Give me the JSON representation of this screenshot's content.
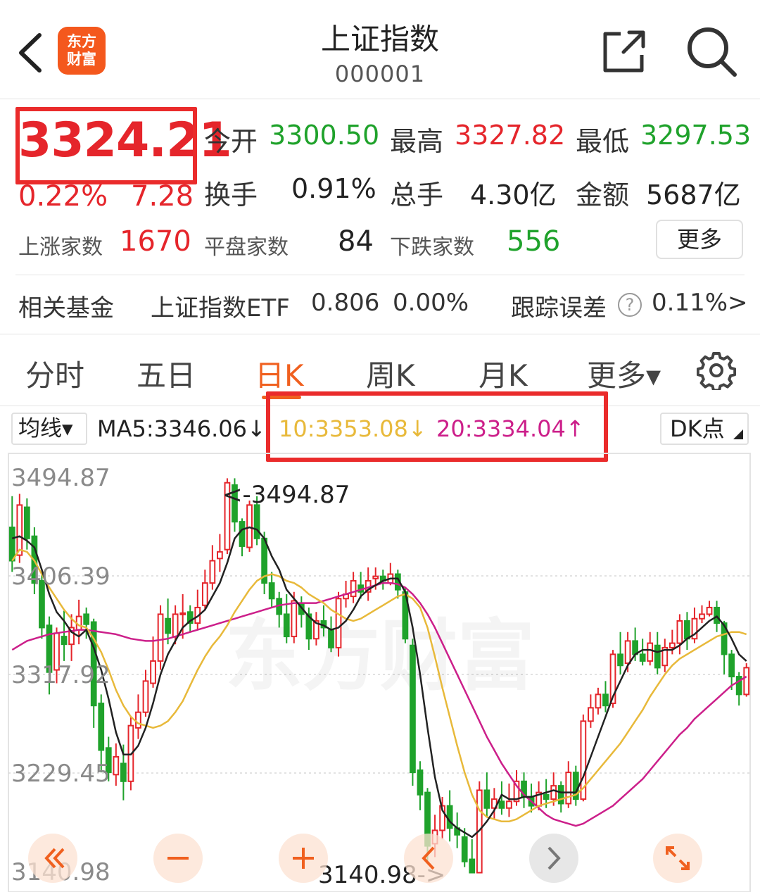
{
  "header": {
    "logo_line1": "东方",
    "logo_line2": "财富",
    "title": "上证指数",
    "code": "000001"
  },
  "quote": {
    "price": "3324.21",
    "change_pct": "0.22%",
    "change_abs": "7.28",
    "stats": [
      {
        "label": "今开",
        "value": "3300.50",
        "color": "#1fa22b"
      },
      {
        "label": "最高",
        "value": "3327.82",
        "color": "#e5252b"
      },
      {
        "label": "最低",
        "value": "3297.53",
        "color": "#1fa22b"
      },
      {
        "label": "换手",
        "value": "0.91%",
        "color": "#222222"
      },
      {
        "label": "总手",
        "value": "4.30亿",
        "color": "#222222"
      },
      {
        "label": "金额",
        "value": "5687亿",
        "color": "#222222"
      }
    ],
    "breadth": [
      {
        "label": "上涨家数",
        "value": "1670",
        "color": "#e5252b"
      },
      {
        "label": "平盘家数",
        "value": "84",
        "color": "#222222"
      },
      {
        "label": "下跌家数",
        "value": "556",
        "color": "#1fa22b"
      }
    ],
    "more_label": "更多"
  },
  "fund": {
    "label": "相关基金",
    "name": "上证指数ETF",
    "price": "0.806",
    "change": "0.00%",
    "tracking_label": "跟踪误差",
    "tracking_value": "0.11%",
    "chevron": ">"
  },
  "tabs": [
    {
      "label": "分时",
      "active": false
    },
    {
      "label": "五日",
      "active": false
    },
    {
      "label": "日K",
      "active": true
    },
    {
      "label": "周K",
      "active": false
    },
    {
      "label": "月K",
      "active": false
    },
    {
      "label": "更多▾",
      "active": false
    }
  ],
  "ma_bar": {
    "select_label": "均线▾",
    "ma5": "MA5:3346.06↓",
    "ma10": "10:3353.08↓",
    "ma20": "20:3334.04↑",
    "dk_label": "DK点"
  },
  "colors": {
    "up": "#e5252b",
    "down": "#1fa22b",
    "accent": "#f0601f",
    "ma5": "#222222",
    "ma10": "#e8b93a",
    "ma20": "#cc1f8a"
  },
  "chart_data": {
    "type": "candlestick",
    "y_ticks": [
      "3494.87",
      "3406.39",
      "3317.92",
      "3229.45",
      "3140.98"
    ],
    "ylim": [
      3140.98,
      3494.87
    ],
    "high_label": "<-3494.87",
    "low_label": "3140.98->",
    "watermark": "东方财富",
    "candles": [
      [
        3450,
        3420,
        3478,
        3410
      ],
      [
        3425,
        3470,
        3480,
        3418
      ],
      [
        3468,
        3440,
        3476,
        3430
      ],
      [
        3442,
        3400,
        3450,
        3390
      ],
      [
        3402,
        3360,
        3410,
        3350
      ],
      [
        3362,
        3320,
        3370,
        3300
      ],
      [
        3322,
        3355,
        3360,
        3310
      ],
      [
        3352,
        3345,
        3375,
        3330
      ],
      [
        3345,
        3360,
        3372,
        3330
      ],
      [
        3358,
        3370,
        3385,
        3345
      ],
      [
        3372,
        3363,
        3378,
        3350
      ],
      [
        3365,
        3290,
        3368,
        3270
      ],
      [
        3292,
        3250,
        3300,
        3230
      ],
      [
        3252,
        3230,
        3262,
        3222
      ],
      [
        3228,
        3244,
        3256,
        3218
      ],
      [
        3238,
        3222,
        3255,
        3205
      ],
      [
        3222,
        3272,
        3280,
        3214
      ],
      [
        3270,
        3284,
        3300,
        3260
      ],
      [
        3284,
        3312,
        3322,
        3280
      ],
      [
        3310,
        3330,
        3352,
        3306
      ],
      [
        3330,
        3372,
        3380,
        3322
      ],
      [
        3368,
        3355,
        3386,
        3345
      ],
      [
        3352,
        3372,
        3380,
        3345
      ],
      [
        3372,
        3373,
        3390,
        3350
      ],
      [
        3374,
        3364,
        3380,
        3356
      ],
      [
        3364,
        3378,
        3394,
        3358
      ],
      [
        3380,
        3400,
        3412,
        3376
      ],
      [
        3400,
        3420,
        3434,
        3394
      ],
      [
        3422,
        3428,
        3444,
        3410
      ],
      [
        3430,
        3490,
        3494,
        3426
      ],
      [
        3488,
        3455,
        3494,
        3446
      ],
      [
        3455,
        3433,
        3458,
        3424
      ],
      [
        3432,
        3470,
        3474,
        3428
      ],
      [
        3470,
        3440,
        3478,
        3434
      ],
      [
        3440,
        3400,
        3446,
        3390
      ],
      [
        3400,
        3386,
        3410,
        3378
      ],
      [
        3386,
        3372,
        3392,
        3360
      ],
      [
        3372,
        3352,
        3390,
        3346
      ],
      [
        3352,
        3384,
        3392,
        3346
      ],
      [
        3382,
        3372,
        3388,
        3360
      ],
      [
        3372,
        3350,
        3378,
        3340
      ],
      [
        3350,
        3366,
        3374,
        3344
      ],
      [
        3366,
        3360,
        3380,
        3352
      ],
      [
        3358,
        3342,
        3370,
        3338
      ],
      [
        3342,
        3386,
        3392,
        3334
      ],
      [
        3386,
        3390,
        3402,
        3378
      ],
      [
        3388,
        3402,
        3410,
        3382
      ],
      [
        3398,
        3392,
        3410,
        3386
      ],
      [
        3392,
        3402,
        3414,
        3384
      ],
      [
        3404,
        3406,
        3414,
        3394
      ],
      [
        3406,
        3402,
        3412,
        3394
      ],
      [
        3400,
        3408,
        3418,
        3398
      ],
      [
        3408,
        3394,
        3412,
        3386
      ],
      [
        3392,
        3350,
        3396,
        3346
      ],
      [
        3344,
        3230,
        3350,
        3218
      ],
      [
        3232,
        3210,
        3240,
        3196
      ],
      [
        3212,
        3164,
        3216,
        3150
      ],
      [
        3166,
        3178,
        3192,
        3154
      ],
      [
        3178,
        3200,
        3208,
        3170
      ],
      [
        3200,
        3180,
        3214,
        3168
      ],
      [
        3180,
        3174,
        3194,
        3162
      ],
      [
        3172,
        3150,
        3180,
        3145
      ],
      [
        3152,
        3140,
        3170,
        3141
      ],
      [
        3140,
        3214,
        3222,
        3141
      ],
      [
        3214,
        3198,
        3230,
        3190
      ],
      [
        3198,
        3206,
        3216,
        3188
      ],
      [
        3204,
        3198,
        3222,
        3192
      ],
      [
        3198,
        3204,
        3220,
        3190
      ],
      [
        3204,
        3222,
        3232,
        3200
      ],
      [
        3222,
        3208,
        3230,
        3198
      ],
      [
        3208,
        3200,
        3220,
        3194
      ],
      [
        3200,
        3212,
        3222,
        3196
      ],
      [
        3210,
        3206,
        3224,
        3198
      ],
      [
        3206,
        3218,
        3230,
        3200
      ],
      [
        3218,
        3202,
        3222,
        3194
      ],
      [
        3202,
        3230,
        3240,
        3198
      ],
      [
        3230,
        3206,
        3236,
        3200
      ],
      [
        3206,
        3276,
        3282,
        3204
      ],
      [
        3276,
        3288,
        3300,
        3270
      ],
      [
        3288,
        3300,
        3306,
        3282
      ],
      [
        3300,
        3290,
        3312,
        3284
      ],
      [
        3292,
        3336,
        3340,
        3288
      ],
      [
        3336,
        3326,
        3356,
        3318
      ],
      [
        3328,
        3348,
        3356,
        3320
      ],
      [
        3348,
        3336,
        3360,
        3330
      ],
      [
        3336,
        3330,
        3350,
        3326
      ],
      [
        3330,
        3346,
        3356,
        3326
      ],
      [
        3344,
        3324,
        3356,
        3318
      ],
      [
        3326,
        3342,
        3350,
        3320
      ],
      [
        3342,
        3346,
        3358,
        3336
      ],
      [
        3346,
        3366,
        3372,
        3336
      ],
      [
        3366,
        3350,
        3374,
        3340
      ],
      [
        3350,
        3368,
        3378,
        3346
      ],
      [
        3368,
        3372,
        3380,
        3364
      ],
      [
        3372,
        3378,
        3384,
        3370
      ],
      [
        3378,
        3364,
        3384,
        3356
      ],
      [
        3364,
        3336,
        3366,
        3318
      ],
      [
        3336,
        3316,
        3340,
        3304
      ],
      [
        3316,
        3300,
        3320,
        3290
      ],
      [
        3300,
        3324,
        3328,
        3298
      ]
    ],
    "ma5": [
      3440,
      3442,
      3438,
      3432,
      3412,
      3390,
      3374,
      3366,
      3356,
      3352,
      3358,
      3342,
      3322,
      3296,
      3266,
      3246,
      3246,
      3254,
      3270,
      3292,
      3318,
      3336,
      3348,
      3360,
      3366,
      3370,
      3376,
      3388,
      3400,
      3418,
      3440,
      3448,
      3450,
      3448,
      3440,
      3424,
      3412,
      3394,
      3386,
      3378,
      3370,
      3364,
      3362,
      3358,
      3360,
      3366,
      3376,
      3388,
      3394,
      3398,
      3402,
      3404,
      3404,
      3392,
      3360,
      3318,
      3270,
      3226,
      3196,
      3186,
      3180,
      3176,
      3172,
      3178,
      3186,
      3196,
      3210,
      3206,
      3206,
      3208,
      3208,
      3210,
      3212,
      3214,
      3212,
      3212,
      3212,
      3226,
      3244,
      3262,
      3280,
      3298,
      3312,
      3326,
      3336,
      3340,
      3340,
      3338,
      3340,
      3340,
      3344,
      3350,
      3354,
      3360,
      3366,
      3370,
      3362,
      3350,
      3336,
      3330
    ],
    "ma10": [
      3420,
      3430,
      3428,
      3420,
      3408,
      3396,
      3386,
      3376,
      3368,
      3362,
      3360,
      3350,
      3338,
      3322,
      3304,
      3290,
      3280,
      3274,
      3272,
      3270,
      3272,
      3276,
      3284,
      3294,
      3308,
      3322,
      3334,
      3344,
      3352,
      3362,
      3374,
      3384,
      3394,
      3402,
      3406,
      3408,
      3406,
      3402,
      3400,
      3396,
      3390,
      3386,
      3382,
      3376,
      3372,
      3368,
      3366,
      3368,
      3372,
      3376,
      3380,
      3384,
      3388,
      3390,
      3386,
      3378,
      3360,
      3334,
      3306,
      3280,
      3254,
      3230,
      3210,
      3196,
      3190,
      3188,
      3186,
      3186,
      3188,
      3192,
      3196,
      3200,
      3202,
      3204,
      3206,
      3208,
      3210,
      3216,
      3224,
      3232,
      3240,
      3248,
      3256,
      3266,
      3276,
      3286,
      3298,
      3308,
      3318,
      3326,
      3332,
      3336,
      3340,
      3344,
      3348,
      3352,
      3354,
      3356,
      3356,
      3354
    ],
    "ma20": [
      3340,
      3344,
      3348,
      3350,
      3352,
      3354,
      3355,
      3356,
      3357,
      3358,
      3358,
      3357,
      3356,
      3355,
      3354,
      3352,
      3350,
      3349,
      3348,
      3348,
      3349,
      3350,
      3352,
      3354,
      3356,
      3358,
      3360,
      3362,
      3364,
      3366,
      3368,
      3370,
      3372,
      3374,
      3376,
      3378,
      3380,
      3381,
      3382,
      3382,
      3382,
      3382,
      3384,
      3386,
      3388,
      3390,
      3392,
      3394,
      3396,
      3398,
      3400,
      3400,
      3399,
      3396,
      3390,
      3382,
      3372,
      3360,
      3346,
      3332,
      3318,
      3304,
      3290,
      3276,
      3262,
      3250,
      3238,
      3228,
      3218,
      3210,
      3204,
      3198,
      3192,
      3188,
      3186,
      3184,
      3182,
      3184,
      3188,
      3192,
      3196,
      3200,
      3206,
      3212,
      3218,
      3224,
      3232,
      3240,
      3248,
      3256,
      3264,
      3270,
      3278,
      3284,
      3290,
      3296,
      3302,
      3308,
      3312,
      3316
    ]
  }
}
